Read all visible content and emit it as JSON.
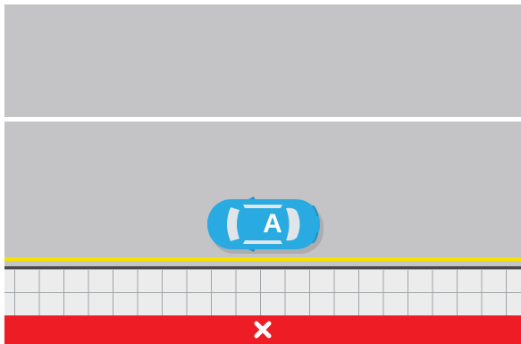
{
  "scene": {
    "colors": {
      "road": "#c4c4c6",
      "lane_marking": "#ffffff",
      "curb_line": "#f6e100",
      "sidewalk": "#ececec",
      "sidewalk_grid": "#9fa5a8",
      "cancel_bar": "#ee1c24",
      "car_body": "#29aae1"
    }
  },
  "car": {
    "label": "A",
    "icon": "car-icon",
    "facing": "right"
  },
  "cancel": {
    "icon": "close-icon"
  }
}
